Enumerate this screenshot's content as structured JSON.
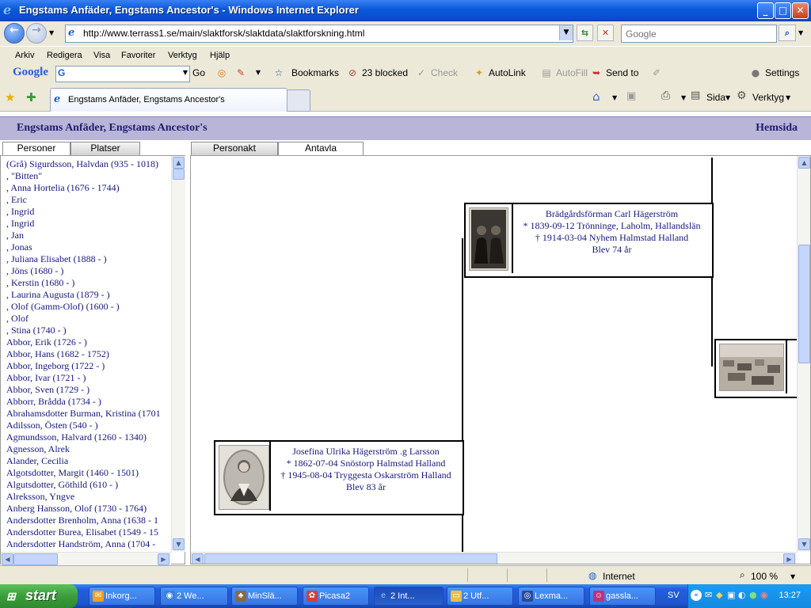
{
  "window": {
    "title": "Engstams Anfäder, Engstams Ancestor's - Windows Internet Explorer",
    "btn_min": "_",
    "btn_max": "□",
    "btn_close": "✕"
  },
  "address": {
    "url": "http://www.terrass1.se/main/slaktforsk/slaktdata/slaktforskning.html",
    "search_placeholder": "Google"
  },
  "menu": [
    "Arkiv",
    "Redigera",
    "Visa",
    "Favoriter",
    "Verktyg",
    "Hjälp"
  ],
  "google_toolbar": {
    "logo": "Google",
    "go": "Go",
    "bookmarks": "Bookmarks",
    "blocked": "23 blocked",
    "check": "Check",
    "autolink": "AutoLink",
    "autofill": "AutoFill",
    "sendto": "Send to",
    "settings": "Settings"
  },
  "tab": {
    "label": "Engstams Anfäder, Engstams Ancestor's"
  },
  "command_bar": {
    "page": "Sida",
    "tools": "Verktyg"
  },
  "page": {
    "title": "Engstams Anfäder, Engstams Ancestor's",
    "home_link": "Hemsida",
    "left_tabs": [
      "Personer",
      "Platser"
    ],
    "right_tabs": [
      "Personakt",
      "Antavla"
    ],
    "persons": [
      "(Grå) Sigurdsson, Halvdan (935 - 1018)",
      ", \"Bitten\"",
      ", Anna Hortelia (1676 - 1744)",
      ", Eric",
      ", Ingrid",
      ", Ingrid",
      ", Jan",
      ", Jonas",
      ", Juliana Elisabet (1888 - )",
      ", Jöns (1680 - )",
      ", Kerstin (1680 - )",
      ", Laurina Augusta (1879 - )",
      ", Olof (Gamm-Olof) (1600 - )",
      ", Olof",
      ", Stina (1740 - )",
      "Abbor, Erik (1726 - )",
      "Abbor, Hans (1682 - 1752)",
      "Abbor, Ingeborg (1722 - )",
      "Abbor, Ivar (1721 - )",
      "Abbor, Sven (1729 - )",
      "Abborr, Brådda (1734 - )",
      "Abrahamsdotter Burman, Kristina (1701",
      "Adilsson, Östen (540 - )",
      "Agmundsson, Halvard (1260 - 1340)",
      "Agnesson, Alrek",
      "Alander, Cecilia",
      "Algotsdotter, Margit (1460 - 1501)",
      "Algutsdotter, Göthild (610 - )",
      "Alreksson, Yngve",
      "Anberg Hansson, Olof (1730 - 1764)",
      "Andersdotter Brenholm, Anna (1638 - 1",
      "Andersdotter Burea, Elisabet (1549 - 15",
      "Andersdotter Handström, Anna (1704 -"
    ],
    "father": {
      "name": "Brädgårdsförman Carl Hägerström",
      "born": "* 1839-09-12 Trönninge, Laholm, Hallandslän",
      "died": "† 1914-03-04 Nyhem Halmstad Halland",
      "age": "Blev 74 år"
    },
    "mother": {
      "name": "Josefina Ulrika Hägerström .g Larsson",
      "born": "* 1862-07-04 Snöstorp Halmstad Halland",
      "died": "† 1945-08-04 Tryggesta Oskarström Halland",
      "age": "Blev 83 år"
    }
  },
  "status": {
    "zone": "Internet",
    "zoom": "100 %"
  },
  "taskbar": {
    "start": "start",
    "tasks": [
      "Inkorg...",
      "2 We...",
      "MinSlä...",
      "Picasa2",
      "2 Int...",
      "2 Utf...",
      "Lexma...",
      "gassla..."
    ],
    "lang": "SV",
    "clock": "13:27"
  }
}
